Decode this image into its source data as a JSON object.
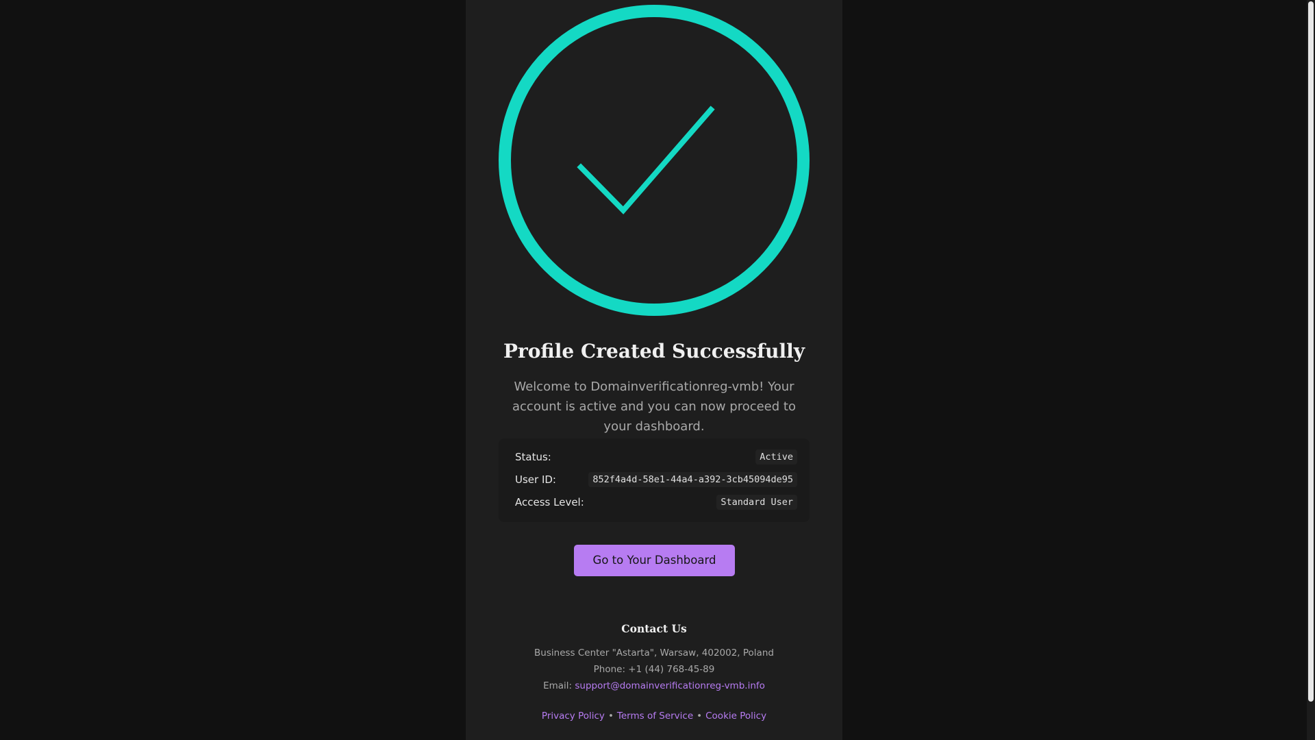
{
  "colors": {
    "accent_teal": "#14d9c4",
    "accent_purple": "#b77cf2",
    "background": "#111111",
    "card": "#1e1e1e"
  },
  "hero": {
    "icon": "check-circle-icon",
    "title": "Profile Created Successfully",
    "message": "Welcome to Domainverificationreg-vmb! Your account is active and you can now proceed to your dashboard."
  },
  "details": [
    {
      "label": "Status:",
      "value": "Active"
    },
    {
      "label": "User ID:",
      "value": "852f4a4d-58e1-44a4-a392-3cb45094de95"
    },
    {
      "label": "Access Level:",
      "value": "Standard User"
    }
  ],
  "cta": {
    "label": "Go to Your Dashboard"
  },
  "contact": {
    "heading": "Contact Us",
    "address": "Business Center \"Astarta\", Warsaw, 402002, Poland",
    "phone": "Phone: +1 (44) 768-45-89",
    "email_prefix": "Email:",
    "email": "support@domainverificationreg-vmb.info"
  },
  "footer": {
    "links": [
      "Privacy Policy",
      "Terms of Service",
      "Cookie Policy"
    ],
    "separator": "•"
  }
}
